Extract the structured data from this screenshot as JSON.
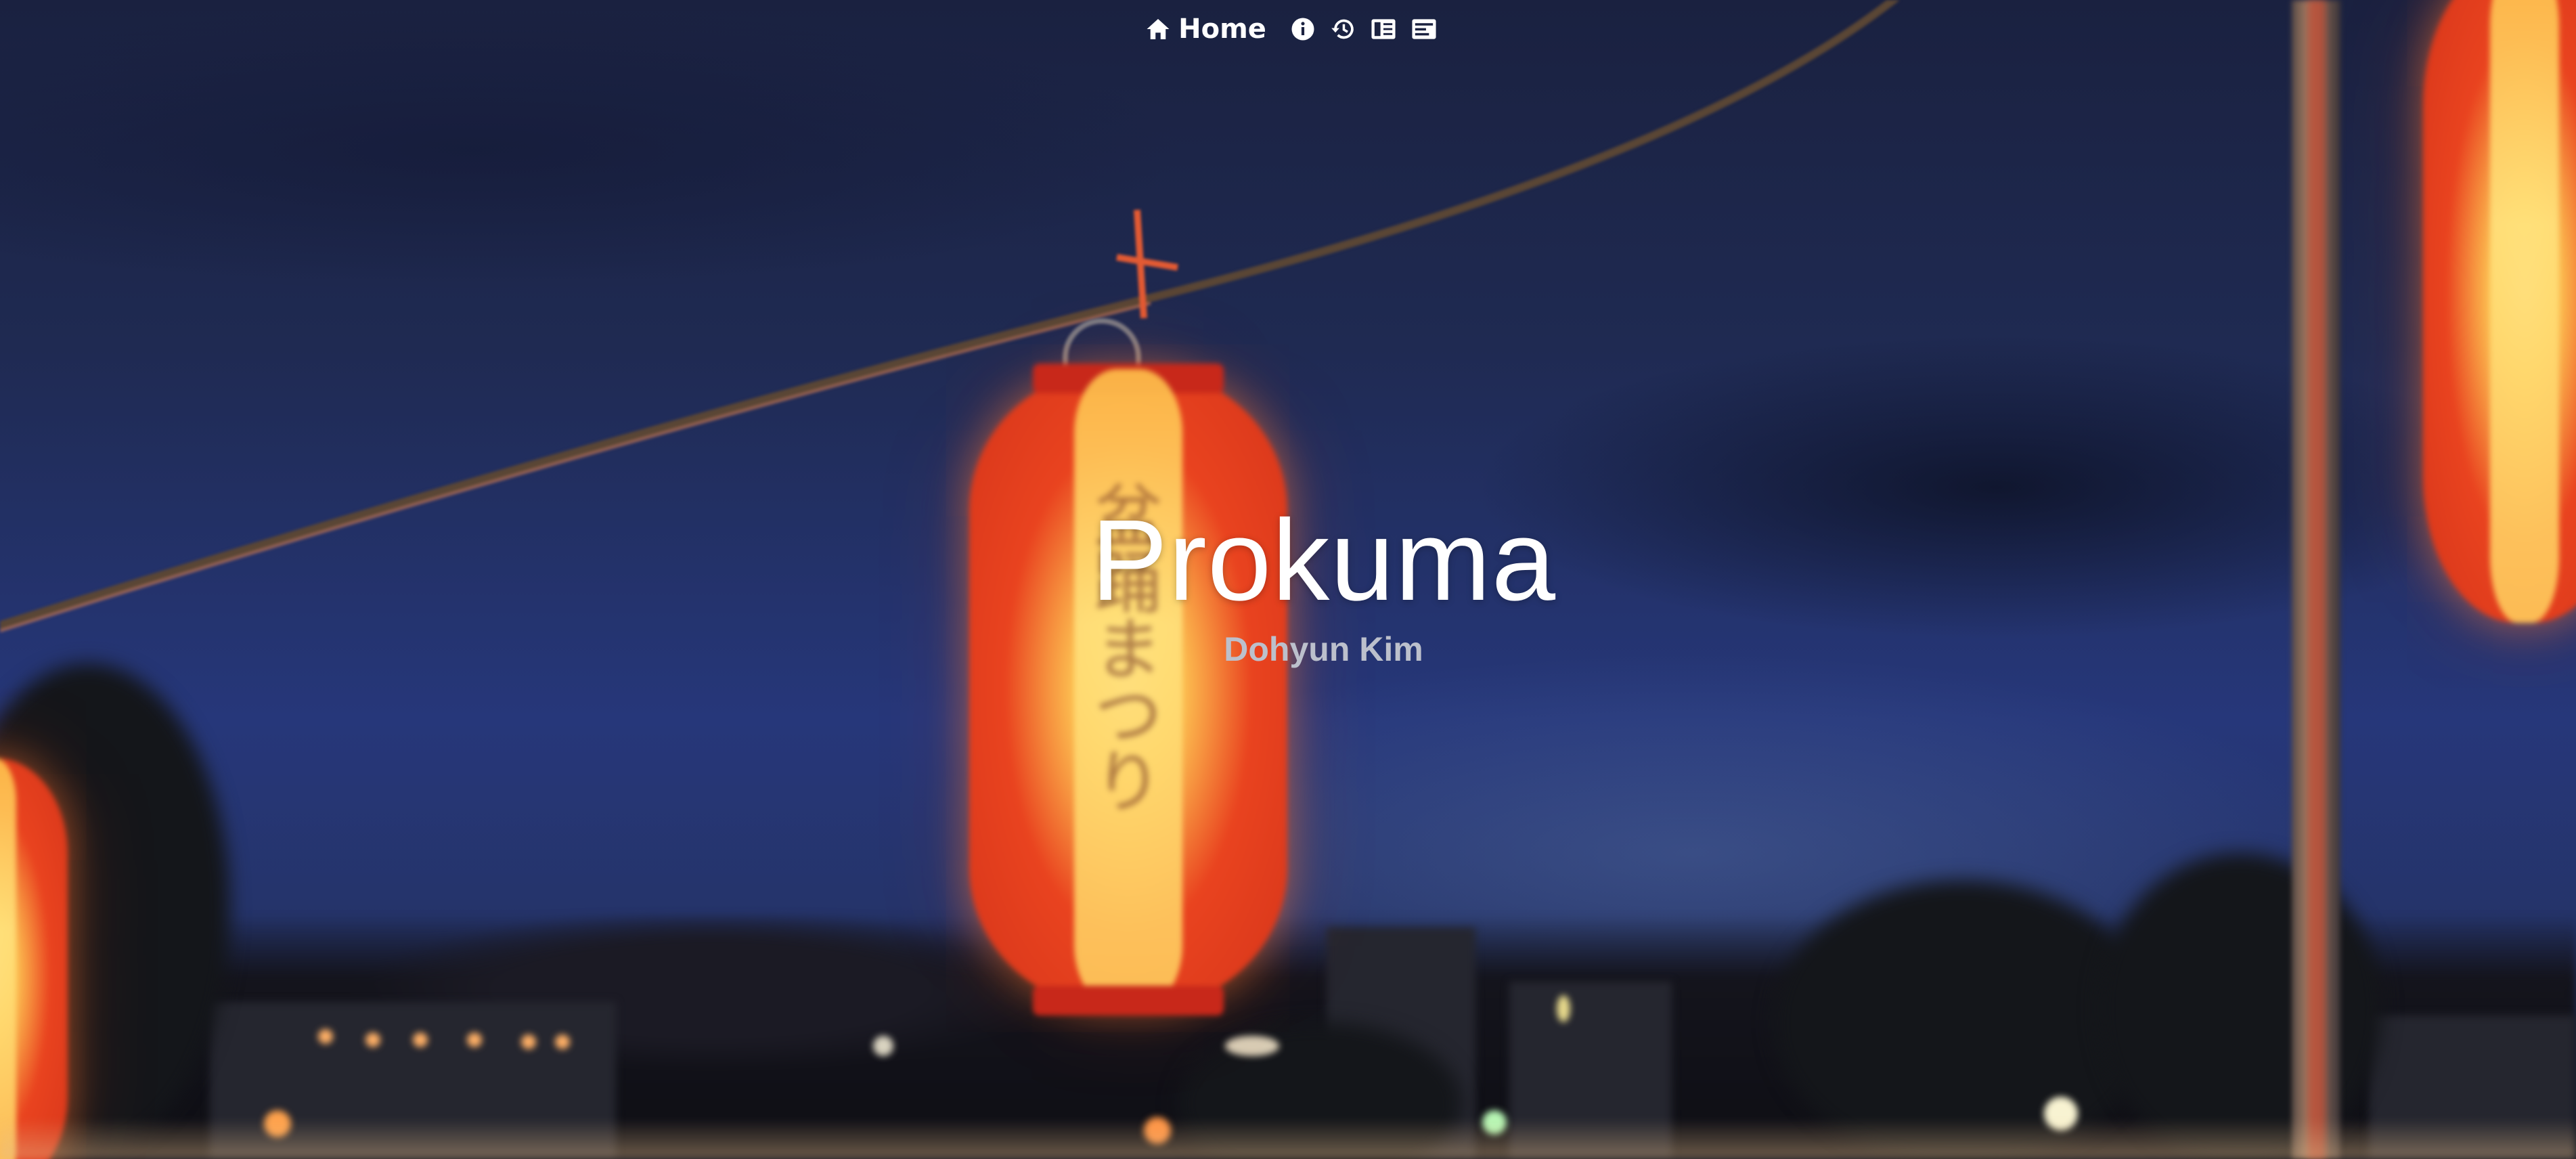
{
  "nav": {
    "items": [
      {
        "label": "Home",
        "icon": "home-icon"
      },
      {
        "label": "",
        "icon": "info-icon"
      },
      {
        "label": "",
        "icon": "history-icon"
      },
      {
        "label": "",
        "icon": "book-icon"
      },
      {
        "label": "",
        "icon": "card-icon"
      }
    ]
  },
  "hero": {
    "title": "Prokuma",
    "subtitle": "Dohyun Kim"
  },
  "lantern_text": "盆踊まつり",
  "colors": {
    "sky": "#1f2a52",
    "lantern": "#e9431f",
    "title": "#ffffff",
    "subtitle": "#bcc0cc"
  }
}
